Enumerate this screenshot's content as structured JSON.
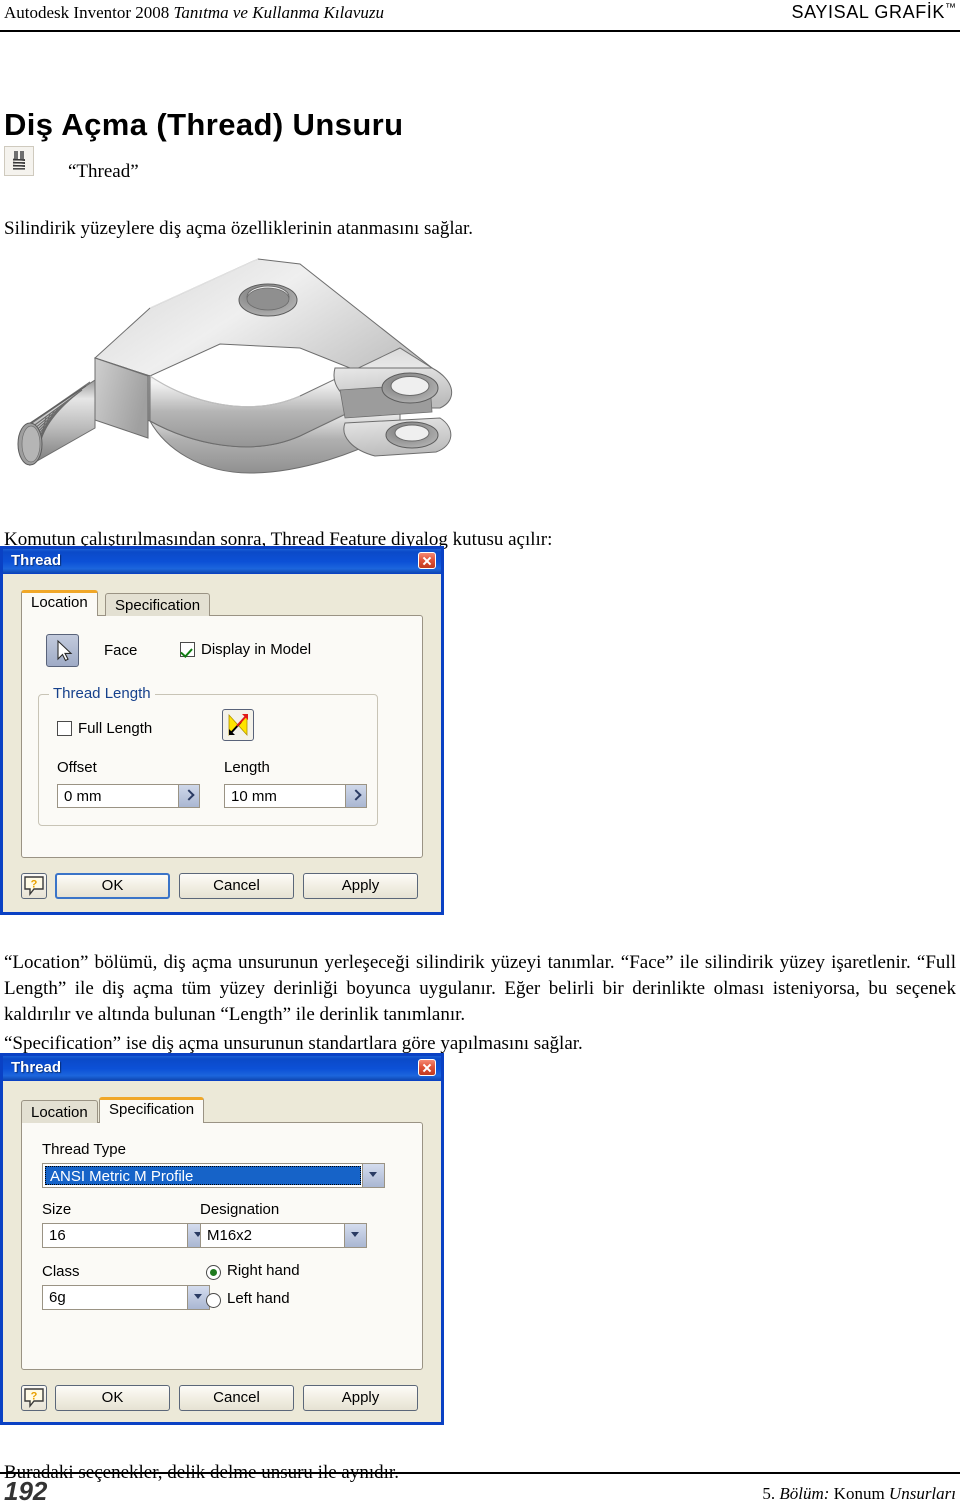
{
  "header": {
    "left_plain": "Autodesk Inventor 2008 ",
    "left_italic": "Tanıtma ve Kullanma Kılavuzu",
    "right": "SAYISAL GRAFİK",
    "right_tm": "™"
  },
  "title": "Diş Açma (Thread) Unsuru",
  "command": {
    "icon": "thread-tool-icon",
    "label": "“Thread”"
  },
  "paragraphs": {
    "intro": "Silindirik yüzeylere diş açma özelliklerinin atanmasını sağlar.",
    "dialog_opens": "Komutun çalıştırılmasından sonra, Thread Feature diyalog kutusu açılır:",
    "location_desc": "“Location” bölümü, diş açma unsurunun yerleşeceği silindirik yüzeyi tanımlar. “Face” ile silindirik yüzey işaretlenir. “Full Length” ile diş açma tüm yüzey derinliği boyunca uygulanır. Eğer belirli bir derinlikte olması isteniyorsa, bu seçenek kaldırılır ve altında bulunan “Length” ile derinlik tanımlanır.",
    "specification_desc": "“Specification” ise diş açma unsurunun standartlara göre yapılmasını sağlar.",
    "same_as_hole": "Buradaki seçenekler, delik delme unsuru ile aynıdır."
  },
  "figure": {
    "alt": "3D CAD rendering of a threaded clevis bracket part"
  },
  "dialog_location": {
    "title": "Thread",
    "close_icon": "close-icon",
    "tabs": [
      {
        "label": "Location",
        "active": true
      },
      {
        "label": "Specification",
        "active": false
      }
    ],
    "face_button_icon": "cursor-arrow-icon",
    "face_label": "Face",
    "display_in_model": {
      "label": "Display in Model",
      "checked": true
    },
    "thread_length_group": {
      "title": "Thread Length",
      "full_length": {
        "label": "Full Length",
        "checked": false
      },
      "flip_icon": "flip-direction-icon",
      "offset_label": "Offset",
      "offset_value": "0 mm",
      "length_label": "Length",
      "length_value": "10 mm"
    },
    "buttons": {
      "help": "?",
      "ok": "OK",
      "cancel": "Cancel",
      "apply": "Apply"
    }
  },
  "dialog_specification": {
    "title": "Thread",
    "close_icon": "close-icon",
    "tabs": [
      {
        "label": "Location",
        "active": false
      },
      {
        "label": "Specification",
        "active": true
      }
    ],
    "thread_type_label": "Thread Type",
    "thread_type_value": "ANSI Metric M Profile",
    "size_label": "Size",
    "size_value": "16",
    "designation_label": "Designation",
    "designation_value": "M16x2",
    "class_label": "Class",
    "class_value": "6g",
    "hand": {
      "right": {
        "label": "Right hand",
        "selected": true
      },
      "left": {
        "label": "Left hand",
        "selected": false
      }
    },
    "buttons": {
      "help": "?",
      "ok": "OK",
      "cancel": "Cancel",
      "apply": "Apply"
    }
  },
  "footer": {
    "page_number": "192",
    "chapter_plain_1": "5. ",
    "chapter_italic_1": "Bölüm: ",
    "chapter_plain_2": "Konum ",
    "chapter_italic_2": "Unsurları"
  },
  "colors": {
    "titlebar_blue": "#0c50d6",
    "dialog_face": "#ece9d8",
    "tab_active_accent": "#f0a728",
    "group_title_blue": "#16418c",
    "selection_blue": "#1663c8",
    "close_red": "#c03a1e"
  }
}
